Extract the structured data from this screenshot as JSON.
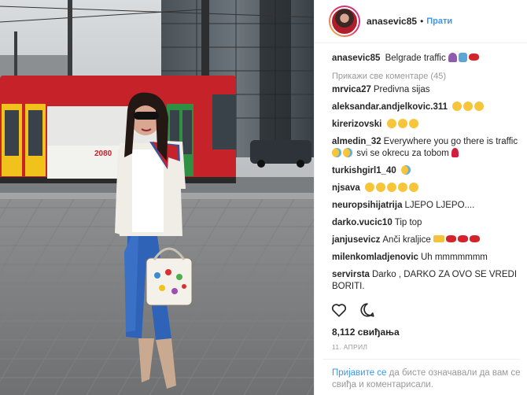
{
  "post": {
    "username": "anasevic85",
    "separator": "•",
    "follow_label": "Прати",
    "caption_user": "anasevic85",
    "caption_text": "Belgrade traffic",
    "view_all_comments": "Прикажи све коментаре (45)",
    "comments": [
      {
        "user": "mrvica27",
        "text": "Predivna sijas",
        "emojis": []
      },
      {
        "user": "aleksandar.andjelkovic.311",
        "text": "",
        "emojis": [
          "face",
          "face",
          "face"
        ]
      },
      {
        "user": "kirerizovski",
        "text": "",
        "emojis": [
          "face",
          "face",
          "face"
        ]
      },
      {
        "user": "almedin_32",
        "text": "Everywhere you go there is traffic",
        "emojis": []
      },
      {
        "user": "turkishgirl1_40",
        "text": "",
        "emojis": [
          "cry"
        ]
      },
      {
        "user": "njsava",
        "text": "",
        "emojis": [
          "face",
          "face",
          "face",
          "face",
          "face"
        ]
      },
      {
        "user": "neuropsihijatrija",
        "text": "LJEPO LJEPO....",
        "emojis": []
      },
      {
        "user": "darko.vucic10",
        "text": "Tip top",
        "emojis": []
      },
      {
        "user": "janjusevicz",
        "text": "Anči kraljice",
        "emojis": [
          "money",
          "lips",
          "lips",
          "lips"
        ]
      },
      {
        "user": "milenkomladjenovic",
        "text": "Uh mmmmmmm",
        "emojis": []
      },
      {
        "user": "servirsta",
        "text": "Darko , DARKO ZA OVO SE VREDI BORITI.",
        "emojis": []
      }
    ],
    "comment_extra": {
      "almedin_tail_text": "svi se okrecu za tobom"
    },
    "likes": "8,112 свиђања",
    "date": "11. АПРИЛ",
    "login_link": "Пријавите се",
    "login_text": " да бисте означавали да вам се свиђа и коментарисали."
  },
  "icons": {
    "like": "heart-outline-icon",
    "comment": "speech-bubble-icon"
  },
  "colors": {
    "link_blue": "#3897f0",
    "muted_gray": "#999999",
    "text": "#262626"
  }
}
